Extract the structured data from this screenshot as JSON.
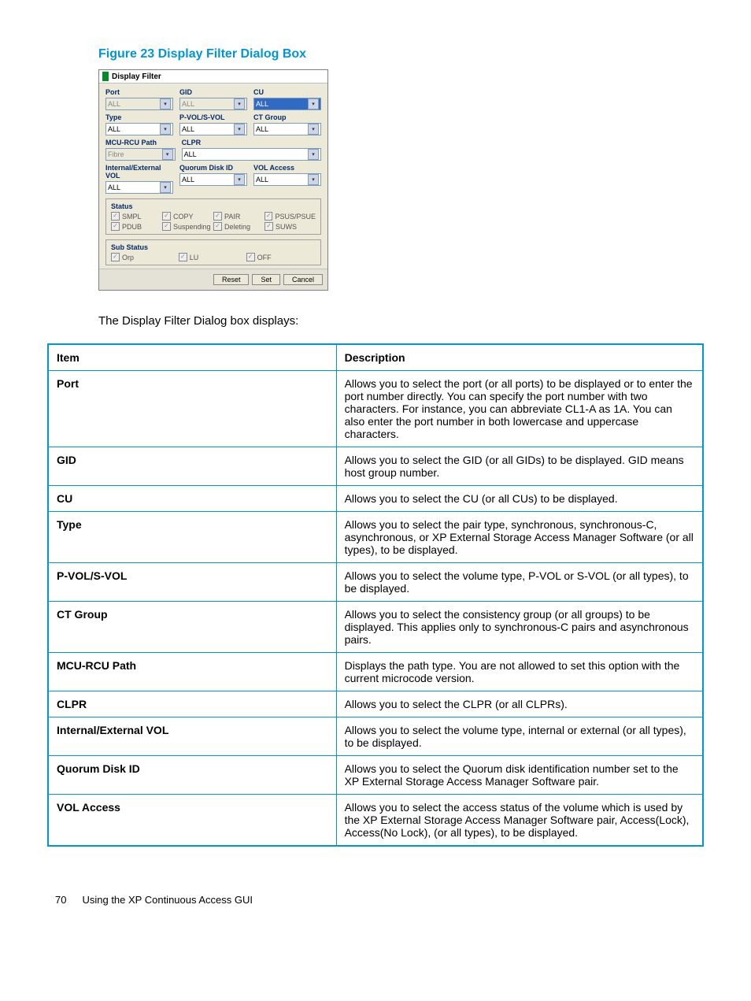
{
  "figure": {
    "title": "Figure 23 Display Filter Dialog Box"
  },
  "dialog": {
    "title": "Display Filter",
    "row1": {
      "port": {
        "label": "Port",
        "value": "ALL"
      },
      "gid": {
        "label": "GID",
        "value": "ALL"
      },
      "cu": {
        "label": "CU",
        "value": "ALL"
      }
    },
    "row2": {
      "type": {
        "label": "Type",
        "value": "ALL"
      },
      "pvolsvol": {
        "label": "P-VOL/S-VOL",
        "value": "ALL"
      },
      "ctgroup": {
        "label": "CT Group",
        "value": "ALL"
      }
    },
    "row3": {
      "mcurcu": {
        "label": "MCU-RCU Path",
        "value": "Fibre"
      },
      "clpr": {
        "label": "CLPR",
        "value": "ALL"
      }
    },
    "row4": {
      "intext": {
        "label": "Internal/External VOL",
        "value": "ALL"
      },
      "quorum": {
        "label": "Quorum Disk ID",
        "value": "ALL"
      },
      "volacc": {
        "label": "VOL Access",
        "value": "ALL"
      }
    },
    "status": {
      "legend": "Status",
      "items": [
        "SMPL",
        "COPY",
        "PAIR",
        "PSUS/PSUE",
        "PDUB",
        "Suspending",
        "Deleting",
        "SUWS"
      ]
    },
    "substatus": {
      "legend": "Sub Status",
      "items": [
        "Orp",
        "LU",
        "OFF"
      ]
    },
    "buttons": {
      "reset": "Reset",
      "set": "Set",
      "cancel": "Cancel"
    }
  },
  "intro": "The Display Filter Dialog box displays:",
  "table": {
    "head": {
      "item": "Item",
      "desc": "Description"
    },
    "rows": [
      {
        "item": "Port",
        "desc": "Allows you to select the port (or all ports) to be displayed or to enter the port number directly. You can specify the port number with two characters. For instance, you can abbreviate CL1-A as 1A. You can also enter the port number in both lowercase and uppercase characters."
      },
      {
        "item": "GID",
        "desc": "Allows you to select the GID (or all GIDs) to be displayed. GID means host group number."
      },
      {
        "item": "CU",
        "desc": "Allows you to select the CU (or all CUs) to be displayed."
      },
      {
        "item": "Type",
        "desc": "Allows you to select the pair type, synchronous, synchronous-C, asynchronous, or XP External Storage Access Manager Software (or all types), to be displayed."
      },
      {
        "item": "P-VOL/S-VOL",
        "desc": "Allows you to select the volume type, P-VOL or S-VOL (or all types), to be displayed."
      },
      {
        "item": "CT Group",
        "desc": "Allows you to select the consistency group (or all groups) to be displayed. This applies only to synchronous-C pairs and asynchronous pairs."
      },
      {
        "item": "MCU-RCU Path",
        "desc": "Displays the path type. You are not allowed to set this option with the current microcode version."
      },
      {
        "item": "CLPR",
        "desc": "Allows you to select the CLPR (or all CLPRs)."
      },
      {
        "item": "Internal/External VOL",
        "desc": "Allows you to select the volume type, internal or external (or all types), to be displayed."
      },
      {
        "item": "Quorum Disk ID",
        "desc": "Allows you to select the Quorum disk identification number set to the XP External Storage Access Manager Software pair."
      },
      {
        "item": "VOL Access",
        "desc": "Allows you to select the access status of the volume which is used by the XP External Storage Access Manager Software pair, Access(Lock), Access(No Lock), (or all types), to be displayed."
      }
    ]
  },
  "footer": {
    "page": "70",
    "text": "Using the XP Continuous Access GUI"
  }
}
